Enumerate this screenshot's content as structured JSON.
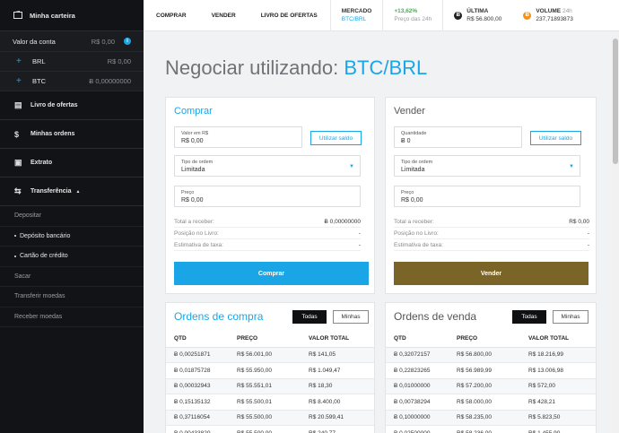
{
  "sidebar": {
    "wallet_title": "Minha carteira",
    "account_value_label": "Valor da conta",
    "account_value": "R$ 0,00",
    "balances": [
      {
        "currency": "BRL",
        "value": "R$ 0,00"
      },
      {
        "currency": "BTC",
        "value": "Ƀ 0,00000000"
      }
    ],
    "nav": [
      {
        "label": "Livro de ofertas",
        "icon": "book-icon"
      },
      {
        "label": "Minhas ordens",
        "icon": "dollar-icon"
      },
      {
        "label": "Extrato",
        "icon": "statement-icon"
      },
      {
        "label": "Transferência",
        "icon": "transfer-icon"
      }
    ],
    "sub": [
      {
        "label": "Depositar"
      },
      {
        "label": "Depósito bancário"
      },
      {
        "label": "Cartão de crédito"
      },
      {
        "label": "Sacar"
      },
      {
        "label": "Transferir moedas"
      },
      {
        "label": "Receber moedas"
      }
    ]
  },
  "topbar": {
    "buy": "COMPRAR",
    "sell": "VENDER",
    "orderbook": "LIVRO DE OFERTAS",
    "market_label": "MERCADO",
    "market_value": "BTC/BRL",
    "change": "+13,62%",
    "change_label": "Preço das 24h",
    "last_label": "ÚLTIMA",
    "last_value": "R$ 56.800,00",
    "volume_label": "VOLUME",
    "volume_period": "24h",
    "volume_value": "237,71893873",
    "coin_symbol": "Ƀ"
  },
  "page": {
    "title_prefix": "Negociar utilizando:",
    "title_pair": "BTC/BRL"
  },
  "buy_form": {
    "title": "Comprar",
    "amount_label": "Valor em R$",
    "amount_value": "R$ 0,00",
    "use_balance": "Utilizar saldo",
    "order_type_label": "Tipo de ordem",
    "order_type_value": "Limitada",
    "price_label": "Preço",
    "price_value": "R$ 0,00",
    "receive_label": "Total a receber:",
    "receive_value": "Ƀ 0,00000000",
    "position_label": "Posição no Livro:",
    "position_value": "-",
    "fee_label": "Estimativa de taxa:",
    "fee_value": "-",
    "submit": "Comprar"
  },
  "sell_form": {
    "title": "Vender",
    "amount_label": "Quantidade",
    "amount_value": "Ƀ 0",
    "use_balance": "Utilizar saldo",
    "order_type_label": "Tipo de ordem",
    "order_type_value": "Limitada",
    "price_label": "Preço",
    "price_value": "R$ 0,00",
    "receive_label": "Total a receber:",
    "receive_value": "R$ 0,00",
    "position_label": "Posição no Livro:",
    "position_value": "-",
    "fee_label": "Estimativa de taxa:",
    "fee_value": "-",
    "submit": "Vender"
  },
  "buy_orders": {
    "title": "Ordens de compra",
    "tab_all": "Todas",
    "tab_mine": "Minhas",
    "headers": [
      "QTD",
      "PREÇO",
      "VALOR TOTAL"
    ],
    "rows": [
      [
        "Ƀ 0,00251871",
        "R$ 56.001,00",
        "R$ 141,05"
      ],
      [
        "Ƀ 0,01875728",
        "R$ 55.950,00",
        "R$ 1.049,47"
      ],
      [
        "Ƀ 0,00032943",
        "R$ 55.551,01",
        "R$ 18,30"
      ],
      [
        "Ƀ 0,15135132",
        "R$ 55.500,01",
        "R$ 8.400,00"
      ],
      [
        "Ƀ 0,37116054",
        "R$ 55.500,00",
        "R$ 20.599,41"
      ],
      [
        "Ƀ 0,00433820",
        "R$ 55.500,00",
        "R$ 240,77"
      ]
    ]
  },
  "sell_orders": {
    "title": "Ordens de venda",
    "tab_all": "Todas",
    "tab_mine": "Minhas",
    "headers": [
      "QTD",
      "PREÇO",
      "VALOR TOTAL"
    ],
    "rows": [
      [
        "Ƀ 0,32072157",
        "R$ 56.800,00",
        "R$ 18.216,99"
      ],
      [
        "Ƀ 0,22823265",
        "R$ 56.989,99",
        "R$ 13.006,98"
      ],
      [
        "Ƀ 0,01000000",
        "R$ 57.200,00",
        "R$ 572,00"
      ],
      [
        "Ƀ 0,00738294",
        "R$ 58.000,00",
        "R$ 428,21"
      ],
      [
        "Ƀ 0,10000000",
        "R$ 58.235,00",
        "R$ 5.823,50"
      ],
      [
        "Ƀ 0,02500000",
        "R$ 58.236,00",
        "R$ 1.455,90"
      ]
    ]
  },
  "colors": {
    "accent": "#1aa6e6",
    "sell_button": "#7a6428",
    "sidebar_bg": "#121316",
    "volume_coin": "#f0931c",
    "last_coin": "#222222"
  }
}
